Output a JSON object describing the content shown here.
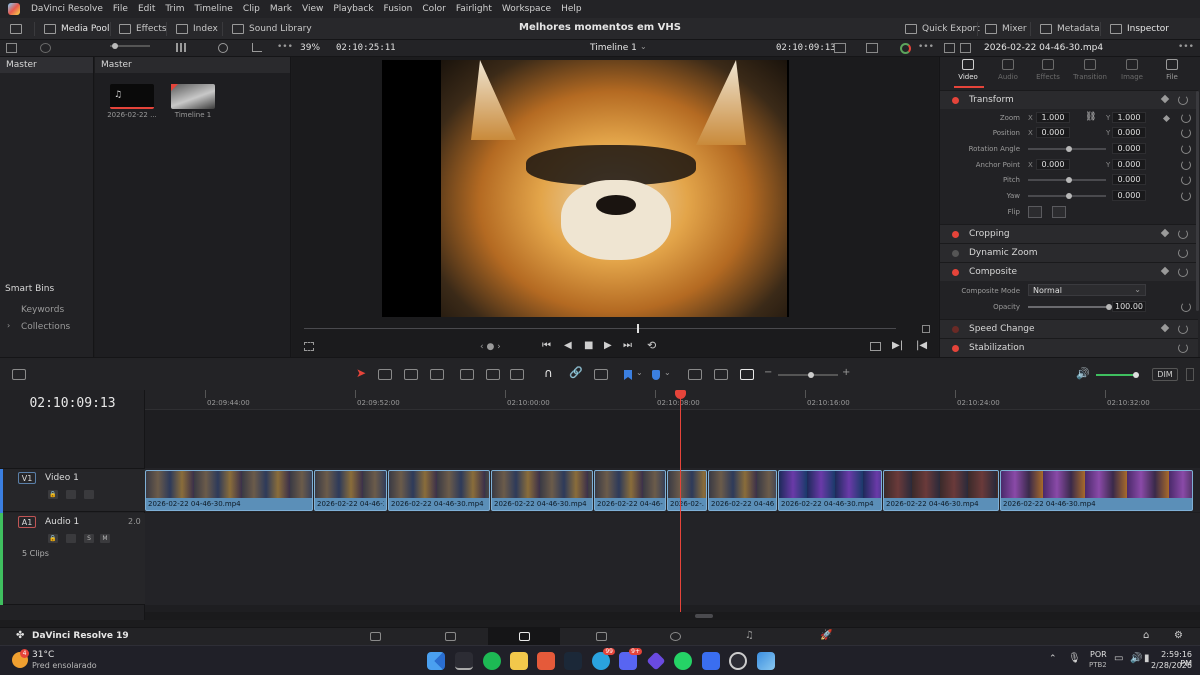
{
  "menu": {
    "app_name": "DaVinci Resolve",
    "items": [
      "File",
      "Edit",
      "Trim",
      "Timeline",
      "Clip",
      "Mark",
      "View",
      "Playback",
      "Fusion",
      "Color",
      "Fairlight",
      "Workspace",
      "Help"
    ]
  },
  "toolbar": {
    "media_pool": "Media Pool",
    "effects": "Effects",
    "index": "Index",
    "sound_library": "Sound Library",
    "project_title": "Melhores momentos em VHS",
    "quick_export": "Quick Export",
    "mixer": "Mixer",
    "metadata": "Metadata",
    "inspector": "Inspector"
  },
  "subbar": {
    "zoom": "39%",
    "source_timecode": "02:10:25:11",
    "timeline_name": "Timeline 1",
    "viewer_timecode": "02:10:09:13",
    "clip_name": "2026-02-22 04-46-30.mp4"
  },
  "bins": {
    "master": "Master",
    "smart_bins": "Smart Bins",
    "keywords": "Keywords",
    "collections": "Collections"
  },
  "pool": {
    "header": "Master",
    "items": [
      {
        "label": "2026-02-22 ..."
      },
      {
        "label": "Timeline 1"
      }
    ]
  },
  "inspector": {
    "tabs": [
      "Video",
      "Audio",
      "Effects",
      "Transition",
      "Image",
      "File"
    ],
    "transform": {
      "title": "Transform",
      "zoom_label": "Zoom",
      "zoom_x": "1.000",
      "zoom_y": "1.000",
      "position_label": "Position",
      "pos_x": "0.000",
      "pos_y": "0.000",
      "rotation_label": "Rotation Angle",
      "rotation": "0.000",
      "anchor_label": "Anchor Point",
      "anchor_x": "0.000",
      "anchor_y": "0.000",
      "pitch_label": "Pitch",
      "pitch": "0.000",
      "yaw_label": "Yaw",
      "yaw": "0.000",
      "flip_label": "Flip",
      "x": "X",
      "y": "Y"
    },
    "cropping": "Cropping",
    "dynamic_zoom": "Dynamic Zoom",
    "composite": {
      "title": "Composite",
      "mode_label": "Composite Mode",
      "mode_value": "Normal",
      "opacity_label": "Opacity",
      "opacity_value": "100.00"
    },
    "speed_change": "Speed Change",
    "stabilization": "Stabilization"
  },
  "timeline": {
    "timecode": "02:10:09:13",
    "dim": "DIM",
    "ruler": [
      "02:09:44:00",
      "02:09:52:00",
      "02:10:00:00",
      "02:10:08:00",
      "02:10:16:00",
      "02:10:24:00",
      "02:10:32:00"
    ],
    "v1_id": "V1",
    "v1_name": "Video 1",
    "a1_id": "A1",
    "a1_name": "Audio 1",
    "a1_channels": "2.0",
    "a1_clips": "5 Clips",
    "solo": "S",
    "mute": "M",
    "clips": [
      "2026-02-22 04-46-30.mp4",
      "2026-02-22 04-46-3...",
      "2026-02-22 04-46-30.mp4",
      "2026-02-22 04-46-30.mp4",
      "2026-02-22 04-46-3...",
      "2026-02-...",
      "2026-02-22 04-46-...",
      "2026-02-22 04-46-30.mp4",
      "2026-02-22 04-46-30.mp4",
      "2026-02-22 04-46-30.mp4"
    ]
  },
  "pagebar": {
    "product": "DaVinci Resolve 19"
  },
  "taskbar": {
    "weather_temp": "31°C",
    "weather_desc": "Pred ensolarado",
    "weather_badge": "4",
    "lang": "POR",
    "layout": "PTB2",
    "time": "2:59:16 PM",
    "date": "2/28/2026",
    "discord_badge": "9+",
    "badge_1": "99"
  },
  "colors": {
    "accent_red": "#e5443a",
    "clip_blue": "#5b8fb8",
    "panel_bg": "#222225"
  }
}
